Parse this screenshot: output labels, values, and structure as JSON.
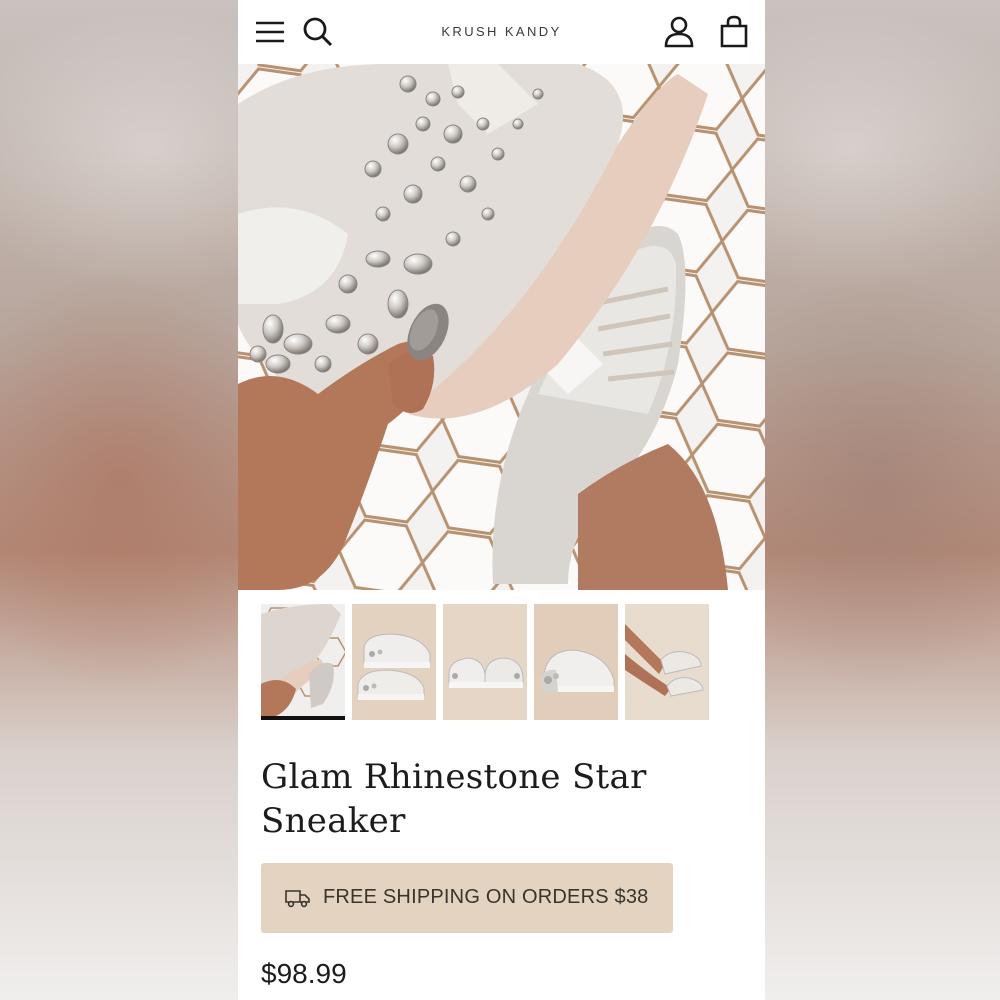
{
  "header": {
    "brand": "KRUSH KANDY",
    "icons": [
      "menu-icon",
      "search-icon",
      "account-icon",
      "cart-icon"
    ]
  },
  "gallery": {
    "thumbnail_count": 5,
    "active_index": 0
  },
  "product": {
    "title_line1": "Glam Rhinestone Star",
    "title_line2": "Sneaker",
    "shipping_banner": "FREE SHIPPING ON ORDERS $38",
    "price": "$98.99"
  },
  "colors": {
    "shipping_bg": "#e3d3c0",
    "text": "#1c1c1c"
  }
}
